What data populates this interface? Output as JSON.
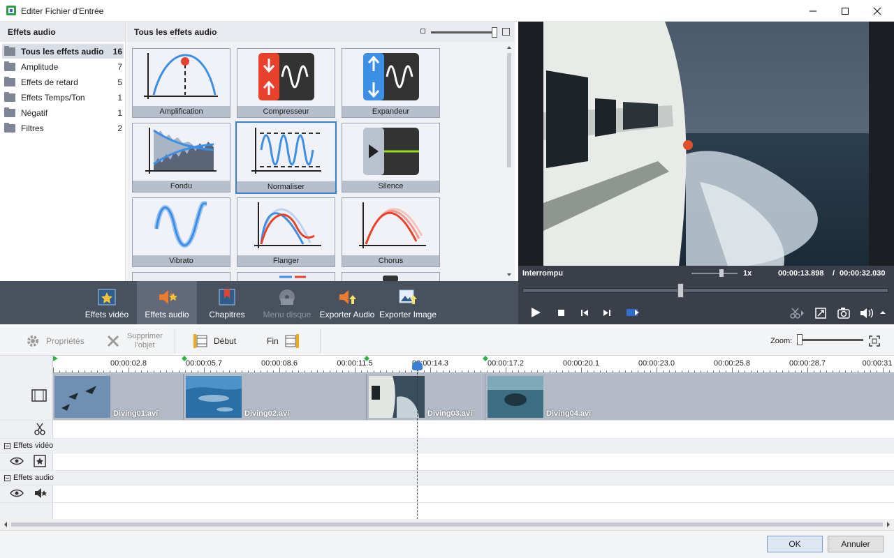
{
  "window": {
    "title": "Editer Fichier d'Entrée"
  },
  "categories": {
    "header": "Effets audio",
    "items": [
      {
        "label": "Tous les effets audio",
        "count": "16",
        "selected": true
      },
      {
        "label": "Amplitude",
        "count": "7"
      },
      {
        "label": "Effets de retard",
        "count": "5"
      },
      {
        "label": "Effets Temps/Ton",
        "count": "1"
      },
      {
        "label": "Négatif",
        "count": "1"
      },
      {
        "label": "Filtres",
        "count": "2"
      }
    ]
  },
  "effects": {
    "header": "Tous les effets audio",
    "tiles": [
      {
        "label": "Amplification",
        "icon": "amplification-icon"
      },
      {
        "label": "Compresseur",
        "icon": "compressor-icon"
      },
      {
        "label": "Expandeur",
        "icon": "expander-icon"
      },
      {
        "label": "Fondu",
        "icon": "fade-icon"
      },
      {
        "label": "Normaliser",
        "icon": "normalize-icon",
        "selected": true
      },
      {
        "label": "Silence",
        "icon": "silence-icon"
      },
      {
        "label": "Vibrato",
        "icon": "vibrato-icon"
      },
      {
        "label": "Flanger",
        "icon": "flanger-icon"
      },
      {
        "label": "Chorus",
        "icon": "chorus-icon"
      }
    ]
  },
  "preview": {
    "status": "Interrompu",
    "speed": "1x",
    "current_time": "00:00:13.898",
    "separator": "/",
    "total_time": "00:00:32.030"
  },
  "toolbar": {
    "video_effects": "Effets vidéo",
    "audio_effects": "Effets audio",
    "chapters": "Chapitres",
    "disc_menu": "Menu disque",
    "export_audio": "Exporter Audio",
    "export_image": "Exporter Image"
  },
  "edit_toolbar": {
    "properties": "Propriétés",
    "delete_object_line1": "Supprimer",
    "delete_object_line2": "l'objet",
    "start": "Début",
    "end": "Fin",
    "zoom_label": "Zoom:"
  },
  "ruler": {
    "labels": [
      "00:00:02.8",
      "00:00:05.7",
      "00:00:08.6",
      "00:00:11.5",
      "00:00:14.3",
      "00:00:17.2",
      "00:00:20.1",
      "00:00:23.0",
      "00:00:25.8",
      "00:00:28.7",
      "00:00:31"
    ]
  },
  "clips": [
    {
      "name": "Diving01.avi"
    },
    {
      "name": "Diving02.avi"
    },
    {
      "name": "Diving03.avi"
    },
    {
      "name": "Diving04.avi"
    }
  ],
  "tracks": {
    "video_effects": "Effets vidéo",
    "audio_effects": "Effets audio"
  },
  "dialog": {
    "ok": "OK",
    "cancel": "Annuler"
  },
  "colors": {
    "accent": "#3b7fd4",
    "band": "#4a515e",
    "red": "#e8412c",
    "blue": "#3d8fe6"
  }
}
